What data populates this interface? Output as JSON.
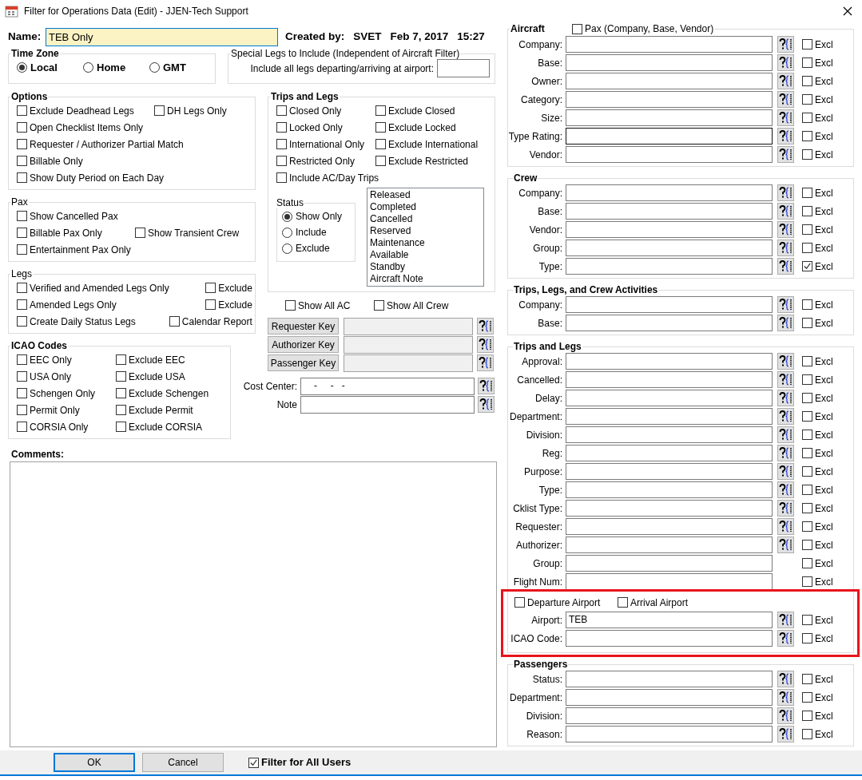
{
  "window": {
    "title": "Filter for Operations Data (Edit) - JJEN-Tech Support"
  },
  "name": {
    "label": "Name:",
    "value": "TEB Only"
  },
  "created": {
    "label": "Created by:",
    "user": "SVET",
    "date": "Feb 7, 2017",
    "time": "15:27"
  },
  "time_zone": {
    "title": "Time Zone",
    "options": [
      {
        "label": "Local",
        "selected": true
      },
      {
        "label": "Home",
        "selected": false
      },
      {
        "label": "GMT",
        "selected": false
      }
    ]
  },
  "special_legs": {
    "title": "Special Legs to Include (Independent of Aircraft Filter)",
    "label": "Include all legs departing/arriving at airport:"
  },
  "options": {
    "title": "Options",
    "rows": [
      [
        {
          "label": "Exclude Deadhead Legs",
          "checked": false
        },
        {
          "label": "DH Legs Only",
          "checked": false
        }
      ],
      [
        {
          "label": "Open Checklist Items Only",
          "checked": false
        }
      ],
      [
        {
          "label": "Requester / Authorizer Partial Match",
          "checked": false
        }
      ],
      [
        {
          "label": "Billable Only",
          "checked": false
        }
      ],
      [
        {
          "label": "Show Duty Period on Each Day",
          "checked": false
        }
      ]
    ]
  },
  "pax": {
    "title": "Pax",
    "rows": [
      [
        {
          "label": "Show Cancelled Pax",
          "checked": false
        }
      ],
      [
        {
          "label": "Billable Pax Only",
          "checked": false
        },
        {
          "label": "Show Transient Crew",
          "checked": false
        }
      ],
      [
        {
          "label": "Entertainment Pax Only",
          "checked": false
        }
      ]
    ]
  },
  "legs": {
    "title": "Legs",
    "rows": [
      [
        {
          "label": "Verified and Amended Legs Only",
          "checked": false
        },
        {
          "label": "Exclude",
          "checked": false
        }
      ],
      [
        {
          "label": "Amended Legs Only",
          "checked": false
        },
        {
          "label": "Exclude",
          "checked": false
        }
      ],
      [
        {
          "label": "Create Daily Status Legs",
          "checked": false
        },
        {
          "label": "Calendar Report",
          "checked": false
        }
      ]
    ]
  },
  "icao_codes": {
    "title": "ICAO Codes",
    "rows": [
      [
        {
          "label": "EEC Only",
          "checked": false
        },
        {
          "label": "Exclude EEC",
          "checked": false
        }
      ],
      [
        {
          "label": "USA Only",
          "checked": false
        },
        {
          "label": "Exclude USA",
          "checked": false
        }
      ],
      [
        {
          "label": "Schengen Only",
          "checked": false
        },
        {
          "label": "Exclude Schengen",
          "checked": false
        }
      ],
      [
        {
          "label": "Permit Only",
          "checked": false
        },
        {
          "label": "Exclude Permit",
          "checked": false
        }
      ],
      [
        {
          "label": "CORSIA Only",
          "checked": false
        },
        {
          "label": "Exclude CORSIA",
          "checked": false
        }
      ]
    ]
  },
  "trips_and_legs": {
    "title": "Trips and Legs",
    "rows": [
      [
        {
          "label": "Closed Only",
          "checked": false
        },
        {
          "label": "Exclude Closed",
          "checked": false
        }
      ],
      [
        {
          "label": "Locked Only",
          "checked": false
        },
        {
          "label": "Exclude Locked",
          "checked": false
        }
      ],
      [
        {
          "label": "International Only",
          "checked": false
        },
        {
          "label": "Exclude International",
          "checked": false
        }
      ],
      [
        {
          "label": "Restricted Only",
          "checked": false
        },
        {
          "label": "Exclude Restricted",
          "checked": false
        }
      ],
      [
        {
          "label": "Include AC/Day Trips",
          "checked": false
        }
      ]
    ],
    "status": {
      "title": "Status",
      "options": [
        {
          "label": "Show Only",
          "selected": true
        },
        {
          "label": "Include",
          "selected": false
        },
        {
          "label": "Exclude",
          "selected": false
        }
      ]
    },
    "status_list": [
      {
        "label": "Released",
        "selected": false
      },
      {
        "label": "Completed",
        "selected": false
      },
      {
        "label": "Cancelled",
        "selected": false
      },
      {
        "label": "Reserved",
        "selected": false
      },
      {
        "label": "Maintenance",
        "selected": false
      },
      {
        "label": "Available",
        "selected": false
      },
      {
        "label": "Standby",
        "selected": false
      },
      {
        "label": "Aircraft Note",
        "selected": false
      }
    ]
  },
  "show_all": [
    {
      "label": "Show All AC",
      "checked": false
    },
    {
      "label": "Show All Crew",
      "checked": false
    }
  ],
  "keys": [
    {
      "label": "Requester Key"
    },
    {
      "label": "Authorizer Key"
    },
    {
      "label": "Passenger Key"
    }
  ],
  "cost_center": {
    "label": "Cost Center:",
    "value": "-     -   -"
  },
  "note": {
    "label": "Note"
  },
  "comments": {
    "label": "Comments:"
  },
  "aircraft": {
    "title": "Aircraft",
    "pax": {
      "label": "Pax (Company, Base, Vendor)",
      "checked": false
    },
    "fields": [
      {
        "label": "Company:",
        "lookup": true,
        "focused": false,
        "excl_label": "Excl",
        "excl": false
      },
      {
        "label": "Base:",
        "lookup": true,
        "focused": false,
        "excl_label": "Excl",
        "excl": false
      },
      {
        "label": "Owner:",
        "lookup": true,
        "focused": false,
        "excl_label": "Excl",
        "excl": false
      },
      {
        "label": "Category:",
        "lookup": true,
        "focused": false,
        "excl_label": "Excl",
        "excl": false
      },
      {
        "label": "Size:",
        "lookup": true,
        "focused": false,
        "excl_label": "Excl",
        "excl": false
      },
      {
        "label": "Type Rating:",
        "lookup": true,
        "focused": true,
        "excl_label": "Excl",
        "excl": false
      },
      {
        "label": "Vendor:",
        "lookup": true,
        "focused": false,
        "excl_label": "Excl",
        "excl": false
      }
    ]
  },
  "crew": {
    "title": "Crew",
    "fields": [
      {
        "label": "Company:",
        "lookup": true,
        "excl_label": "Excl",
        "excl": false
      },
      {
        "label": "Base:",
        "lookup": true,
        "excl_label": "Excl",
        "excl": false
      },
      {
        "label": "Vendor:",
        "lookup": true,
        "excl_label": "Excl",
        "excl": false
      },
      {
        "label": "Group:",
        "lookup": true,
        "excl_label": "Excl",
        "excl": false
      },
      {
        "label": "Type:",
        "lookup": true,
        "excl_label": "Excl",
        "excl": true
      }
    ]
  },
  "activities": {
    "title": "Trips, Legs, and Crew Activities",
    "fields": [
      {
        "label": "Company:",
        "lookup": true,
        "excl_label": "Excl",
        "excl": false
      },
      {
        "label": "Base:",
        "lookup": true,
        "excl_label": "Excl",
        "excl": false
      }
    ]
  },
  "trips_and_legs_filters": {
    "title": "Trips and Legs",
    "fields": [
      {
        "label": "Approval:",
        "lookup": true,
        "excl_label": "Excl",
        "excl": false
      },
      {
        "label": "Cancelled:",
        "lookup": true,
        "excl_label": "Excl",
        "excl": false
      },
      {
        "label": "Delay:",
        "lookup": true,
        "excl_label": "Excl",
        "excl": false
      },
      {
        "label": "Department:",
        "lookup": true,
        "excl_label": "Excl",
        "excl": false
      },
      {
        "label": "Division:",
        "lookup": true,
        "excl_label": "Excl",
        "excl": false
      },
      {
        "label": "Reg:",
        "lookup": true,
        "excl_label": "Excl",
        "excl": false
      },
      {
        "label": "Purpose:",
        "lookup": true,
        "excl_label": "Excl",
        "excl": false
      },
      {
        "label": "Type:",
        "lookup": true,
        "excl_label": "Excl",
        "excl": false
      },
      {
        "label": "Cklist Type:",
        "lookup": true,
        "excl_label": "Excl",
        "excl": false
      },
      {
        "label": "Requester:",
        "lookup": true,
        "excl_label": "Excl",
        "excl": false
      },
      {
        "label": "Authorizer:",
        "lookup": true,
        "excl_label": "Excl",
        "excl": false
      },
      {
        "label": "Group:",
        "lookup": false,
        "excl_label": "Excl",
        "excl": false
      },
      {
        "label": "Flight Num:",
        "lookup": false,
        "excl_label": "Excl",
        "excl": false
      }
    ],
    "highlighted": true,
    "airport_checks": [
      {
        "label": "Departure Airport",
        "checked": false
      },
      {
        "label": "Arrival Airport",
        "checked": false
      }
    ],
    "airport_fields": [
      {
        "label": "Airport:",
        "value": "TEB",
        "lookup": true,
        "excl_label": "Excl",
        "excl": false
      },
      {
        "label": "ICAO Code:",
        "lookup": true,
        "excl_label": "Excl",
        "excl": false
      }
    ]
  },
  "passengers": {
    "title": "Passengers",
    "fields": [
      {
        "label": "Status:",
        "lookup": true,
        "excl_label": "Excl",
        "excl": false
      },
      {
        "label": "Department:",
        "lookup": true,
        "excl_label": "Excl",
        "excl": false
      },
      {
        "label": "Division:",
        "lookup": true,
        "excl_label": "Excl",
        "excl": false
      },
      {
        "label": "Reason:",
        "lookup": true,
        "excl_label": "Excl",
        "excl": false
      }
    ]
  },
  "buttons": [
    {
      "label": "OK",
      "default": true
    },
    {
      "label": "Cancel",
      "default": false
    }
  ],
  "filter_all_users": {
    "label": "Filter for All Users",
    "checked": true
  }
}
